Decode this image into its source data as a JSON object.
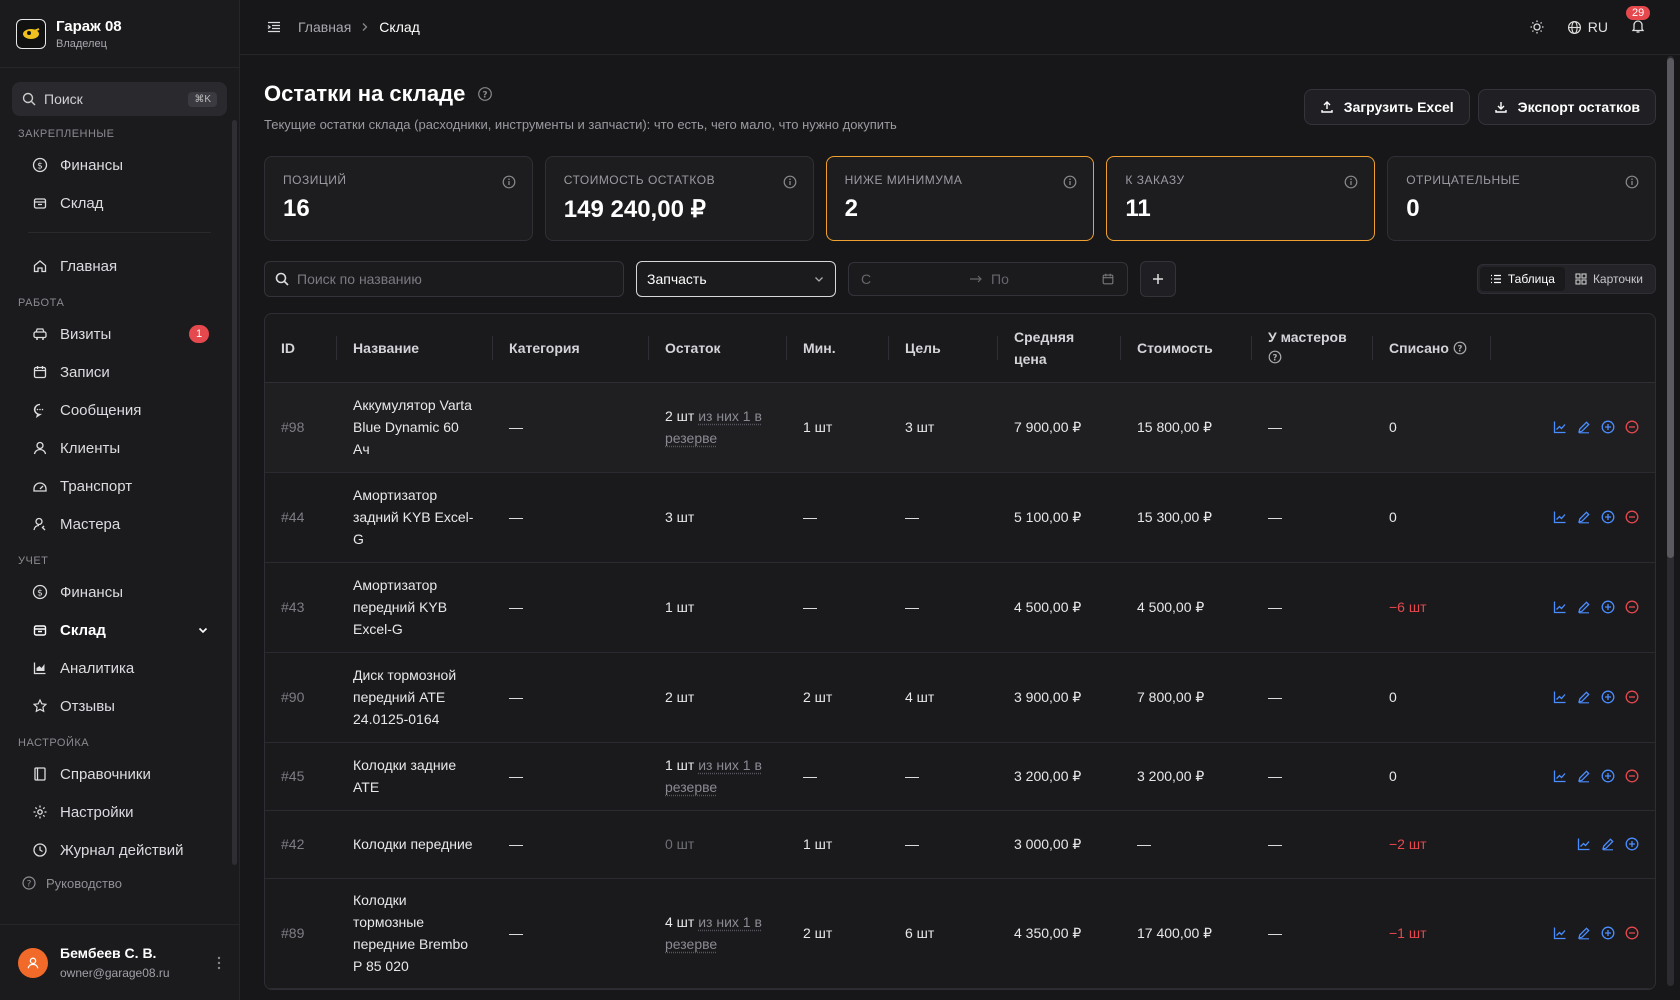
{
  "brand": {
    "name": "Гараж 08",
    "role": "Владелец"
  },
  "sidebar": {
    "search_label": "Поиск",
    "search_kbd": "⌘K",
    "pinned_title": "Закрепленные",
    "pinned": [
      {
        "label": "Финансы",
        "icon": "dollar-circle-icon"
      },
      {
        "label": "Склад",
        "icon": "box-icon"
      }
    ],
    "home_label": "Главная",
    "work_title": "Работа",
    "work": [
      {
        "label": "Визиты",
        "icon": "car-icon",
        "badge": "1"
      },
      {
        "label": "Записи",
        "icon": "calendar-icon"
      },
      {
        "label": "Сообщения",
        "icon": "chat-icon"
      },
      {
        "label": "Клиенты",
        "icon": "user-icon"
      },
      {
        "label": "Транспорт",
        "icon": "gauge-icon"
      },
      {
        "label": "Мастера",
        "icon": "mechanics-icon"
      }
    ],
    "accounting_title": "Учет",
    "accounting": [
      {
        "label": "Финансы",
        "icon": "dollar-circle-icon"
      },
      {
        "label": "Склад",
        "icon": "box-icon"
      },
      {
        "label": "Аналитика",
        "icon": "chart-icon"
      },
      {
        "label": "Отзывы",
        "icon": "star-icon"
      }
    ],
    "settings_title": "Настройка",
    "settings": [
      {
        "label": "Справочники",
        "icon": "book-icon"
      },
      {
        "label": "Настройки",
        "icon": "gear-icon"
      },
      {
        "label": "Журнал действий",
        "icon": "history-icon"
      }
    ],
    "guide_label": "Руководство",
    "user": {
      "name": "Бембеев С. В.",
      "email": "owner@garage08.ru"
    }
  },
  "topbar": {
    "breadcrumb": [
      "Главная",
      "Склад"
    ],
    "lang": "RU",
    "notifications": "29"
  },
  "page": {
    "title": "Остатки на складе",
    "subtitle": "Текущие остатки склада (расходники, инструменты и запчасти): что есть, чего мало, что нужно докупить",
    "upload_label": "Загрузить Excel",
    "export_label": "Экспорт остатков"
  },
  "stats": [
    {
      "label": "Позиций",
      "value": "16",
      "highlight": false
    },
    {
      "label": "Стоимость остатков",
      "value": "149 240,00 ₽",
      "highlight": false
    },
    {
      "label": "Ниже минимума",
      "value": "2",
      "highlight": true
    },
    {
      "label": "К заказу",
      "value": "11",
      "highlight": true
    },
    {
      "label": "Отрицательные",
      "value": "0",
      "highlight": false
    }
  ],
  "filters": {
    "search_placeholder": "Поиск по названию",
    "category_selected": "Запчасть",
    "date_from": "С",
    "date_to": "По",
    "view_table": "Таблица",
    "view_cards": "Карточки"
  },
  "table": {
    "columns": [
      "ID",
      "Название",
      "Категория",
      "Остаток",
      "Мин.",
      "Цель",
      "Средняя цена",
      "Стоимость",
      "У мастеров",
      "Списано"
    ],
    "rows": [
      {
        "id": "#98",
        "name": "Аккумулятор Varta Blue Dynamic 60 Ач",
        "category": "—",
        "stock": "2 шт",
        "reserve": "из них 1 в резерве",
        "min": "1 шт",
        "target": "3 шт",
        "avg": "7 900,00 ₽",
        "cost": "15 800,00 ₽",
        "masters": "—",
        "written": "0",
        "written_neg": false,
        "stock_dim": false,
        "actions": [
          "chart",
          "edit",
          "plus",
          "minus"
        ]
      },
      {
        "id": "#44",
        "name": "Амортизатор задний KYB Excel-G",
        "category": "—",
        "stock": "3 шт",
        "reserve": "",
        "min": "—",
        "target": "—",
        "avg": "5 100,00 ₽",
        "cost": "15 300,00 ₽",
        "masters": "—",
        "written": "0",
        "written_neg": false,
        "stock_dim": false,
        "actions": [
          "chart",
          "edit",
          "plus",
          "minus"
        ]
      },
      {
        "id": "#43",
        "name": "Амортизатор передний KYB Excel-G",
        "category": "—",
        "stock": "1 шт",
        "reserve": "",
        "min": "—",
        "target": "—",
        "avg": "4 500,00 ₽",
        "cost": "4 500,00 ₽",
        "masters": "—",
        "written": "−6 шт",
        "written_neg": true,
        "stock_dim": false,
        "actions": [
          "chart",
          "edit",
          "plus",
          "minus"
        ]
      },
      {
        "id": "#90",
        "name": "Диск тормозной передний ATE 24.0125-0164",
        "category": "—",
        "stock": "2 шт",
        "reserve": "",
        "min": "2 шт",
        "target": "4 шт",
        "avg": "3 900,00 ₽",
        "cost": "7 800,00 ₽",
        "masters": "—",
        "written": "0",
        "written_neg": false,
        "stock_dim": false,
        "actions": [
          "chart",
          "edit",
          "plus",
          "minus"
        ]
      },
      {
        "id": "#45",
        "name": "Колодки задние ATE",
        "category": "—",
        "stock": "1 шт",
        "reserve": "из них 1 в резерве",
        "min": "—",
        "target": "—",
        "avg": "3 200,00 ₽",
        "cost": "3 200,00 ₽",
        "masters": "—",
        "written": "0",
        "written_neg": false,
        "stock_dim": false,
        "actions": [
          "chart",
          "edit",
          "plus",
          "minus"
        ]
      },
      {
        "id": "#42",
        "name": "Колодки передние",
        "category": "—",
        "stock": "0 шт",
        "reserve": "",
        "min": "1 шт",
        "target": "—",
        "avg": "3 000,00 ₽",
        "cost": "—",
        "masters": "—",
        "written": "−2 шт",
        "written_neg": true,
        "stock_dim": true,
        "actions": [
          "chart",
          "edit",
          "plus"
        ]
      },
      {
        "id": "#89",
        "name": "Колодки тормозные передние Brembo P 85 020",
        "category": "—",
        "stock": "4 шт",
        "reserve": "из них 1 в резерве",
        "min": "2 шт",
        "target": "6 шт",
        "avg": "4 350,00 ₽",
        "cost": "17 400,00 ₽",
        "masters": "—",
        "written": "−1 шт",
        "written_neg": true,
        "stock_dim": false,
        "actions": [
          "chart",
          "edit",
          "plus",
          "minus"
        ]
      }
    ]
  },
  "colors": {
    "accent_blue": "#4a8dff",
    "danger": "#e5484d",
    "warn": "#f0a030"
  }
}
